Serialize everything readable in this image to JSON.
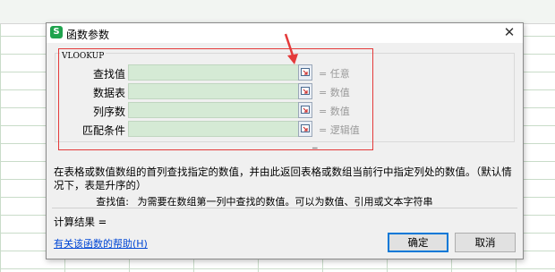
{
  "dialog": {
    "title": "函数参数",
    "app_icon_letter": "S",
    "close_glyph": "✕"
  },
  "function": {
    "name": "VLOOKUP",
    "args": [
      {
        "label": "查找值",
        "hint": "= 任意"
      },
      {
        "label": "数据表",
        "hint": "= 数值"
      },
      {
        "label": "列序数",
        "hint": "= 数值"
      },
      {
        "label": "匹配条件",
        "hint": "= 逻辑值"
      }
    ],
    "result_eq": "="
  },
  "description": "在表格或数值数组的首列查找指定的数值，并由此返回表格或数组当前行中指定列处的数值。（默认情况下，表是升序的）",
  "param_help": {
    "name": "查找值:",
    "text": "为需要在数组第一列中查找的数值。可以为数值、引用或文本字符串"
  },
  "calc_result": "计算结果 =",
  "help_link": "有关该函数的帮助(H)",
  "buttons": {
    "ok": "确定",
    "cancel": "取消"
  },
  "colors": {
    "annotation": "#e43a3a",
    "field_bg": "#d5ead5",
    "link": "#0046d5"
  }
}
